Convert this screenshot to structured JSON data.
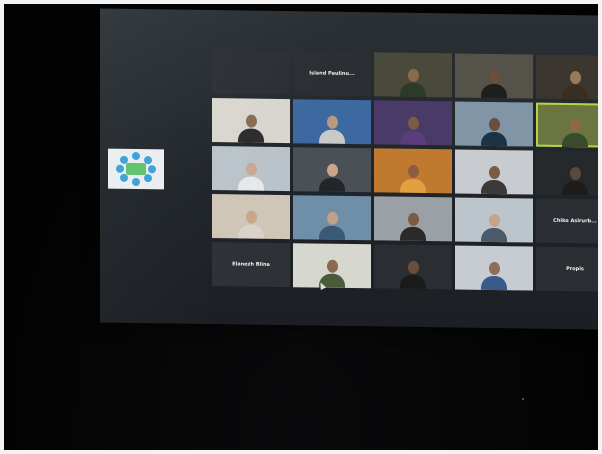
{
  "meeting": {
    "shared_logo": "meeting-logo",
    "tiles": [
      {
        "label": "",
        "type": "blank",
        "bg": "#2b2f33"
      },
      {
        "label": "Island Paulinu...",
        "type": "name",
        "bg": "#2b2f33"
      },
      {
        "label": "",
        "type": "video",
        "bg": "#4a4a3c",
        "skin": "#8a6a4c",
        "shirt": "#2d3a2a"
      },
      {
        "label": "",
        "type": "video",
        "bg": "#55524a",
        "skin": "#6b4f3a",
        "shirt": "#1e1e1e"
      },
      {
        "label": "",
        "type": "video",
        "bg": "#3b3630",
        "skin": "#9a7a5a",
        "shirt": "#3a2e22"
      },
      {
        "label": "",
        "type": "video",
        "bg": "#d9d6d0",
        "skin": "#8a6a52",
        "shirt": "#2c2c2c"
      },
      {
        "label": "",
        "type": "video",
        "bg": "#3c6aa0",
        "skin": "#b99a80",
        "shirt": "#c9c9c9"
      },
      {
        "label": "",
        "type": "video",
        "bg": "#4a3a68",
        "skin": "#7a5d46",
        "shirt": "#5a3d7a"
      },
      {
        "label": "",
        "type": "video",
        "bg": "#8095a5",
        "skin": "#6a4d3a",
        "shirt": "#1b3344"
      },
      {
        "label": "",
        "type": "video",
        "bg": "#6a7540",
        "skin": "#8a6a4a",
        "shirt": "#3a4a2a",
        "active": true
      },
      {
        "label": "",
        "type": "video",
        "bg": "#b9c3c9",
        "skin": "#caa890",
        "shirt": "#e8e8e8"
      },
      {
        "label": "",
        "type": "video",
        "bg": "#4b4f56",
        "skin": "#c9a58a",
        "shirt": "#22262a"
      },
      {
        "label": "",
        "type": "video",
        "bg": "#c07a30",
        "skin": "#8a5e3e",
        "shirt": "#e2a040"
      },
      {
        "label": "",
        "type": "video",
        "bg": "#c8ccd0",
        "skin": "#7a5c44",
        "shirt": "#3a3a3a"
      },
      {
        "label": "",
        "type": "video",
        "bg": "#26292c",
        "skin": "#5a4a3e",
        "shirt": "#1c1c1c"
      },
      {
        "label": "",
        "type": "video",
        "bg": "#cfc6b8",
        "skin": "#c9a58c",
        "shirt": "#d8d2c8"
      },
      {
        "label": "",
        "type": "video",
        "bg": "#6f8ea8",
        "skin": "#c0a088",
        "shirt": "#3a5a78"
      },
      {
        "label": "",
        "type": "video",
        "bg": "#9aa0a6",
        "skin": "#7a5c46",
        "shirt": "#2a2a2a"
      },
      {
        "label": "",
        "type": "video",
        "bg": "#bdc5cc",
        "skin": "#c4a48a",
        "shirt": "#4a5a6a"
      },
      {
        "label": "Chiko Asirurb...",
        "type": "name",
        "bg": "#2b2f33"
      },
      {
        "label": "Elanezh Blina",
        "type": "name",
        "bg": "#2e3237"
      },
      {
        "label": "",
        "type": "video",
        "bg": "#d6d8cf",
        "skin": "#8a6a50",
        "shirt": "#4b5a3a"
      },
      {
        "label": "",
        "type": "video",
        "bg": "#2a2d31",
        "skin": "#6a4e3a",
        "shirt": "#1a1a1a"
      },
      {
        "label": "",
        "type": "video",
        "bg": "#c6ccd2",
        "skin": "#8a6e56",
        "shirt": "#3a5a8a"
      },
      {
        "label": "Propis",
        "type": "name",
        "bg": "#2b2f33"
      }
    ]
  }
}
